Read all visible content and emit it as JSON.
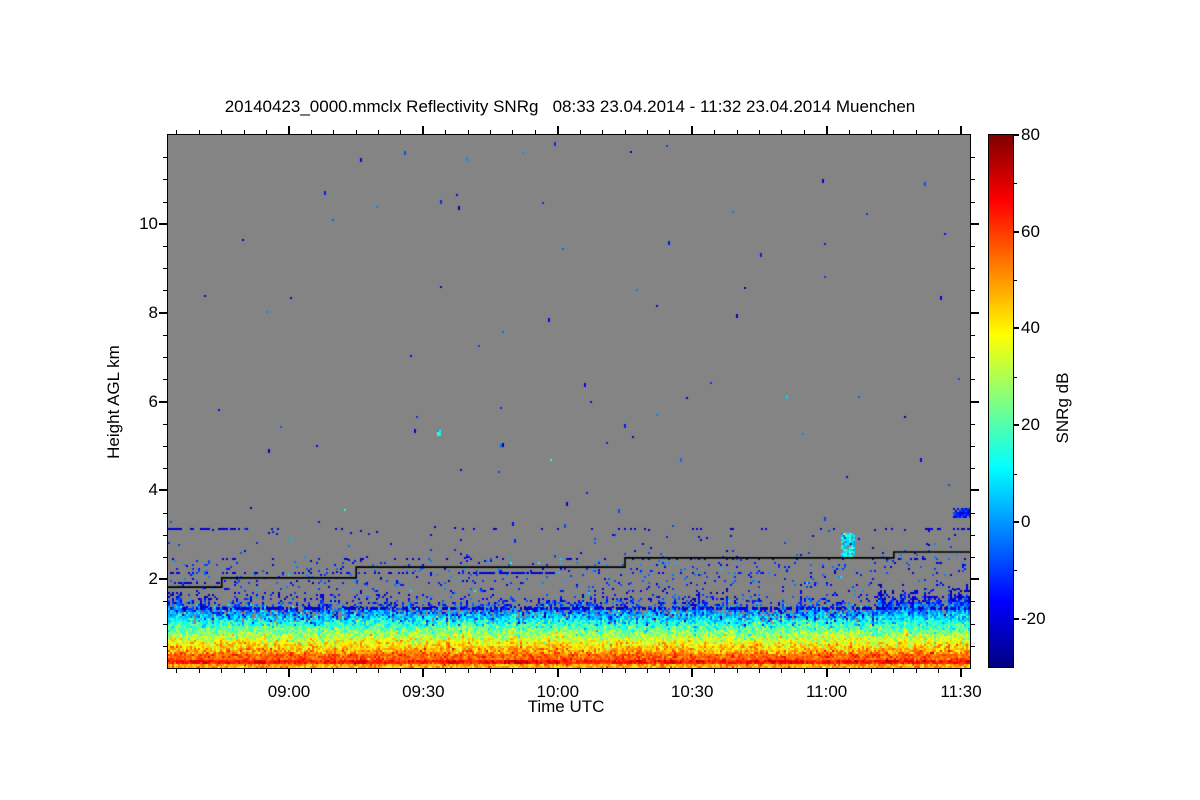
{
  "chart_data": {
    "type": "heatmap",
    "title": "20140423_0000.mmclx Reflectivity SNRg   08:33 23.04.2014 - 11:32 23.04.2014 Muenchen",
    "xlabel": "Time UTC",
    "ylabel": "Height AGL km",
    "station": "Muenchen",
    "time_start": "08:33 23.04.2014",
    "time_end": "11:32 23.04.2014",
    "x_span_minutes": 179,
    "x_ticks": [
      {
        "label": "09:00",
        "minute": 27
      },
      {
        "label": "09:30",
        "minute": 57
      },
      {
        "label": "10:00",
        "minute": 87
      },
      {
        "label": "10:30",
        "minute": 117
      },
      {
        "label": "11:00",
        "minute": 147
      },
      {
        "label": "11:30",
        "minute": 177
      }
    ],
    "x_minor_step_minutes": 5,
    "ylim_km": [
      0,
      12
    ],
    "y_ticks_km": [
      2,
      4,
      6,
      8,
      10
    ],
    "y_minor_step_km": 0.5,
    "background_color": "#848484",
    "grid": false,
    "colorbar": {
      "label": "SNRg dB",
      "min_db": -30,
      "max_db": 80,
      "ticks_db": [
        -20,
        0,
        20,
        40,
        60,
        80
      ],
      "minor_ticks_db": [
        -10,
        10,
        30,
        50,
        70
      ],
      "jet_stops_bottom_to_top": [
        "#000080",
        "#0000ff",
        "#0080ff",
        "#00ffff",
        "#80ff80",
        "#ffff00",
        "#ff8000",
        "#ff0000",
        "#800000"
      ]
    },
    "boundary_layer_signal": {
      "surface_band_db": 63,
      "surface_band_top_km": 0.2,
      "near_surface_db": 48,
      "lapse_db_per_km": 54.5,
      "lapse_ref_db_at_0km": 69.4,
      "signal_top_km_mean": 1.65,
      "signal_top_km_jitter": 0.45,
      "taller_towers": [
        {
          "t0_min": 158,
          "t1_min": 171,
          "extra_km": 0.3
        },
        {
          "t0_min": 174,
          "t1_min": 179,
          "extra_km": 0.45
        },
        {
          "t0_min": 0,
          "t1_min": 3,
          "extra_km": 0.3
        }
      ]
    },
    "cloud_base_line": {
      "color": "#000000",
      "points_min_km": [
        [
          0,
          1.82
        ],
        [
          12,
          1.82
        ],
        [
          12,
          2.03
        ],
        [
          42,
          2.03
        ],
        [
          42,
          2.27
        ],
        [
          102,
          2.27
        ],
        [
          102,
          2.48
        ],
        [
          162,
          2.48
        ],
        [
          162,
          2.61
        ],
        [
          179,
          2.61
        ]
      ]
    },
    "speckle_layers": [
      {
        "km": 1.35,
        "db": -21,
        "thickness_px": 3,
        "segments_min_cov": [
          [
            0,
            179,
            0.5
          ]
        ]
      },
      {
        "km": 1.92,
        "db": -21,
        "thickness_px": 2,
        "segments_min_cov": [
          [
            0,
            12,
            0.3
          ]
        ]
      },
      {
        "km": 2.13,
        "db": -21,
        "thickness_px": 2,
        "segments_min_cov": [
          [
            0,
            68,
            0.15
          ],
          [
            68,
            87,
            0.78
          ],
          [
            87,
            179,
            0.05
          ]
        ]
      },
      {
        "km": 2.45,
        "db": -21,
        "thickness_px": 2,
        "segments_min_cov": [
          [
            0,
            179,
            0.12
          ]
        ]
      },
      {
        "km": 3.13,
        "db": -21,
        "thickness_px": 2,
        "segments_min_cov": [
          [
            0,
            19,
            0.6
          ],
          [
            19,
            100,
            0.06
          ],
          [
            100,
            126,
            0.22
          ],
          [
            126,
            168,
            0.05
          ],
          [
            168,
            179,
            0.45
          ]
        ]
      }
    ],
    "features": [
      {
        "name": "cyan-streak",
        "t0_min": 150.3,
        "t1_min": 153.0,
        "km0": 2.52,
        "km1": 3.02,
        "db": 10
      },
      {
        "name": "right-edge-blob",
        "t0_min": 175.2,
        "t1_min": 178.9,
        "km0": 3.4,
        "km1": 3.62,
        "db": -17
      },
      {
        "name": "cyan-dot",
        "t0_min": 60,
        "t1_min": 60.7,
        "km0": 5.25,
        "km1": 5.38,
        "db": 12
      }
    ],
    "sparse_dots": {
      "count_upper": 90,
      "count_midzone": 120,
      "db_mean": -13,
      "km_range_upper": [
        1.95,
        11.85
      ],
      "km_range_mid": [
        1.7,
        3.2
      ]
    }
  }
}
